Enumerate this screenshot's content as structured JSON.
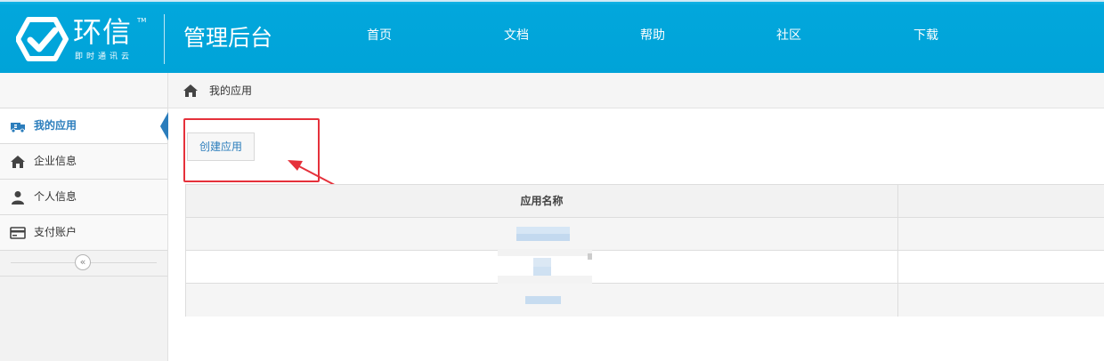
{
  "header": {
    "logo_main": "环信",
    "logo_tm": "TM",
    "logo_sub": "即时通讯云",
    "title": "管理后台",
    "nav": [
      {
        "label": "首页"
      },
      {
        "label": "文档"
      },
      {
        "label": "帮助"
      },
      {
        "label": "社区"
      },
      {
        "label": "下载"
      }
    ]
  },
  "sidebar": {
    "items": [
      {
        "label": "我的应用",
        "icon": "app-icon",
        "active": true
      },
      {
        "label": "企业信息",
        "icon": "home-icon"
      },
      {
        "label": "个人信息",
        "icon": "user-icon"
      },
      {
        "label": "支付账户",
        "icon": "credit-card-icon"
      }
    ],
    "collapse_symbol": "«"
  },
  "breadcrumb": {
    "icon": "home-icon",
    "current": "我的应用"
  },
  "content": {
    "create_button": "创建应用",
    "table": {
      "columns": [
        "应用名称"
      ]
    }
  },
  "colors": {
    "header_bg": "#00a3d8",
    "accent": "#2b7dbc",
    "annotation": "#e5313b"
  }
}
